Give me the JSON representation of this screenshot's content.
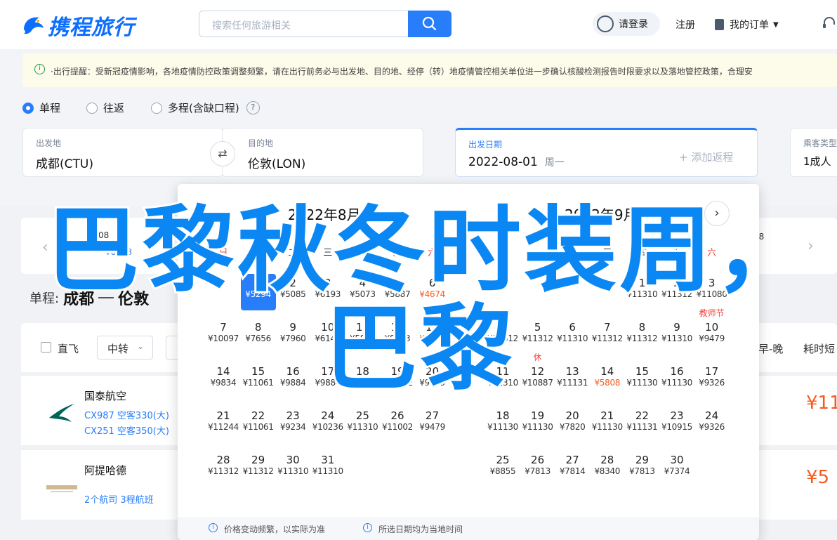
{
  "header": {
    "logo_text": "携程旅行",
    "search_placeholder": "搜索任何旅游相关",
    "login": "请登录",
    "register": "注册",
    "orders": "我的订单"
  },
  "notice": {
    "text": "·出行提醒：受新冠疫情影响，各地疫情防控政策调整频繁，请在出行前务必与出发地、目的地、经停（转）地疫情管控相关单位进一步确认核酸检测报告时限要求以及落地管控政策，合理安"
  },
  "trip_types": [
    "单程",
    "往返",
    "多程(含缺口程)"
  ],
  "search": {
    "from_label": "出发地",
    "from_value": "成都(CTU)",
    "to_label": "目的地",
    "to_value": "伦敦(LON)",
    "date_label": "出发日期",
    "date_value": "2022-08-01",
    "date_dow": "周一",
    "add_return": "+ 添加返程",
    "pax_label": "乘客类型",
    "pax_value": "1成人"
  },
  "pricebar": {
    "item_date": "08",
    "item_price": "¥6543",
    "right_item": "08"
  },
  "route": {
    "prefix": "单程:",
    "from": "成都",
    "to": "伦敦"
  },
  "filters": {
    "direct": "直飞",
    "transfer": "中转",
    "sort_early": "早-晚",
    "sort_duration": "耗时短"
  },
  "flights": [
    {
      "airline": "国泰航空",
      "line1": "CX987 空客330(大)",
      "line2": "CX251 空客350(大)",
      "price": "¥11"
    },
    {
      "airline": "阿提哈德",
      "line1": "2个航司   3程航班",
      "line2": "",
      "price": "¥5"
    }
  ],
  "calendar": {
    "month_left": "2022年8月",
    "month_right": "2022年9月",
    "weekdays": [
      "日",
      "一",
      "二",
      "三",
      "四",
      "五",
      "六"
    ],
    "aug": [
      {
        "d": "1",
        "p": "¥5294",
        "sel": true
      },
      {
        "d": "2",
        "p": "¥5085"
      },
      {
        "d": "3",
        "p": "¥6193"
      },
      {
        "d": "4",
        "p": "¥5073"
      },
      {
        "d": "5",
        "p": "¥5887"
      },
      {
        "d": "6",
        "p": "¥4674",
        "low": true
      },
      {
        "d": "7",
        "p": "¥10097"
      },
      {
        "d": "8",
        "p": "¥7656"
      },
      {
        "d": "9",
        "p": "¥7960"
      },
      {
        "d": "10",
        "p": "¥6141"
      },
      {
        "d": "11",
        "p": "¥5887"
      },
      {
        "d": "12",
        "p": "¥8563"
      },
      {
        "d": "13",
        "p": "¥4674",
        "low": true
      },
      {
        "d": "14",
        "p": "¥9834"
      },
      {
        "d": "15",
        "p": "¥11061"
      },
      {
        "d": "16",
        "p": "¥9884"
      },
      {
        "d": "17",
        "p": "¥9884"
      },
      {
        "d": "18",
        "p": "¥10030"
      },
      {
        "d": "19",
        "p": "¥11002"
      },
      {
        "d": "20",
        "p": "¥9479"
      },
      {
        "d": "21",
        "p": "¥11244"
      },
      {
        "d": "22",
        "p": "¥11061"
      },
      {
        "d": "23",
        "p": "¥9234"
      },
      {
        "d": "24",
        "p": "¥10236"
      },
      {
        "d": "25",
        "p": "¥11310"
      },
      {
        "d": "26",
        "p": "¥11002"
      },
      {
        "d": "27",
        "p": "¥9479"
      },
      {
        "d": "28",
        "p": "¥11312"
      },
      {
        "d": "29",
        "p": "¥11312"
      },
      {
        "d": "30",
        "p": "¥11310"
      },
      {
        "d": "31",
        "p": "¥11310"
      }
    ],
    "sep": [
      {
        "d": "1",
        "p": "¥11310"
      },
      {
        "d": "2",
        "p": "¥11312"
      },
      {
        "d": "3",
        "p": "¥11080"
      },
      {
        "d": "4",
        "p": "¥11312"
      },
      {
        "d": "5",
        "p": "¥11312"
      },
      {
        "d": "6",
        "p": "¥11310"
      },
      {
        "d": "7",
        "p": "¥11312"
      },
      {
        "d": "8",
        "p": "¥11312"
      },
      {
        "d": "9",
        "p": "¥11310"
      },
      {
        "d": "10",
        "p": "¥9479",
        "tag": "教师节"
      },
      {
        "d": "11",
        "p": "¥11310",
        "tag": "休"
      },
      {
        "d": "12",
        "p": "¥10887",
        "tag": "休"
      },
      {
        "d": "13",
        "p": "¥11131"
      },
      {
        "d": "14",
        "p": "¥5808",
        "low": true
      },
      {
        "d": "15",
        "p": "¥11130"
      },
      {
        "d": "16",
        "p": "¥11130"
      },
      {
        "d": "17",
        "p": "¥9326"
      },
      {
        "d": "18",
        "p": "¥11130"
      },
      {
        "d": "19",
        "p": "¥11130"
      },
      {
        "d": "20",
        "p": "¥7820"
      },
      {
        "d": "21",
        "p": "¥11130"
      },
      {
        "d": "22",
        "p": "¥11131"
      },
      {
        "d": "23",
        "p": "¥10915"
      },
      {
        "d": "24",
        "p": "¥9326"
      },
      {
        "d": "25",
        "p": "¥8855"
      },
      {
        "d": "26",
        "p": "¥7813"
      },
      {
        "d": "27",
        "p": "¥7814"
      },
      {
        "d": "28",
        "p": "¥8340"
      },
      {
        "d": "29",
        "p": "¥7813"
      },
      {
        "d": "30",
        "p": "¥7374"
      }
    ],
    "footer_1": "价格变动频繁，以实际为准",
    "footer_2": "所选日期均为当地时间"
  },
  "overlay": {
    "line1": "巴黎秋冬时装周，",
    "line2": "巴黎"
  },
  "colors": {
    "accent": "#287dfa",
    "price_low": "#f55b1f",
    "holiday": "#f0463c",
    "overlay": "#0a87f2"
  }
}
